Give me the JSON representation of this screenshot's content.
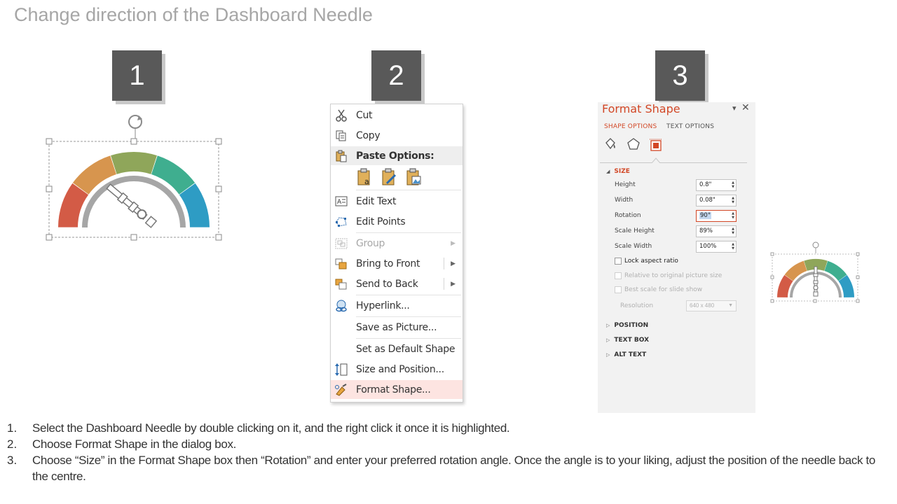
{
  "title": "Change direction of the Dashboard Needle",
  "steps": [
    "1",
    "2",
    "3"
  ],
  "colors": {
    "gauge_red": "#d35b46",
    "gauge_orange": "#d7954e",
    "gauge_green": "#8fa65a",
    "gauge_teal": "#3fae8f",
    "gauge_blue": "#2e9cc4",
    "gauge_inner": "#a6a6a6",
    "accent": "#d24726",
    "badge": "#595959"
  },
  "context_menu": {
    "items": [
      {
        "label": "Cut",
        "icon": "scissors-icon"
      },
      {
        "label": "Copy",
        "icon": "copy-icon"
      },
      {
        "label": "Paste Options:",
        "icon": "paste-icon"
      },
      {
        "label": "Edit Text",
        "icon": "edit-text-icon"
      },
      {
        "label": "Edit Points",
        "icon": "edit-points-icon"
      },
      {
        "label": "Group",
        "icon": "group-icon",
        "disabled": true
      },
      {
        "label": "Bring to Front",
        "icon": "bring-front-icon"
      },
      {
        "label": "Send to Back",
        "icon": "send-back-icon"
      },
      {
        "label": "Hyperlink...",
        "icon": "hyperlink-icon"
      },
      {
        "label": "Save as Picture..."
      },
      {
        "label": "Set as Default Shape"
      },
      {
        "label": "Size and Position...",
        "icon": "size-position-icon"
      },
      {
        "label": "Format Shape...",
        "icon": "format-shape-icon"
      }
    ]
  },
  "format_panel": {
    "title": "Format Shape",
    "tabs": [
      "SHAPE OPTIONS",
      "TEXT OPTIONS"
    ],
    "size_section": "SIZE",
    "fields": [
      {
        "label": "Height",
        "value": "0.8\""
      },
      {
        "label": "Width",
        "value": "0.08\""
      },
      {
        "label": "Rotation",
        "value": "90°"
      },
      {
        "label": "Scale Height",
        "value": "89%"
      },
      {
        "label": "Scale Width",
        "value": "100%"
      }
    ],
    "checks": [
      {
        "label": "Lock aspect ratio"
      },
      {
        "label": "Relative to original picture size"
      },
      {
        "label": "Best scale for slide show"
      }
    ],
    "resolution_label": "Resolution",
    "resolution_value": "640 x 480",
    "sections": [
      "POSITION",
      "TEXT BOX",
      "ALT TEXT"
    ]
  },
  "instructions": [
    {
      "num": "1.",
      "text": "Select the Dashboard Needle by double clicking on it, and the right click it once it is highlighted."
    },
    {
      "num": "2.",
      "text": "Choose Format Shape in the dialog box."
    },
    {
      "num": "3.",
      "text": "Choose “Size” in the Format Shape box then “Rotation” and enter your preferred rotation angle. Once the angle is to your liking, adjust the position of the needle back to the centre."
    }
  ]
}
